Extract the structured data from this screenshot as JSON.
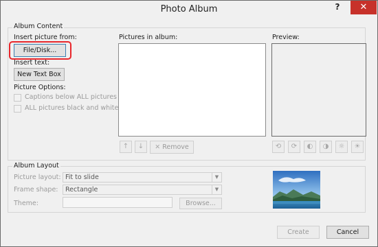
{
  "window": {
    "title": "Photo Album",
    "help": "?",
    "close": "✕"
  },
  "album_content": {
    "group_label": "Album Content",
    "insert_picture_from": "Insert picture from:",
    "file_disk_button": "File/Disk...",
    "insert_text": "Insert text:",
    "new_text_box_button": "New Text Box",
    "picture_options": "Picture Options:",
    "captions_below": "Captions below ALL pictures",
    "black_and_white": "ALL pictures black and white",
    "pictures_in_album": "Pictures in album:",
    "preview": "Preview:",
    "remove_button": "Remove"
  },
  "album_layout": {
    "group_label": "Album Layout",
    "picture_layout_label": "Picture layout:",
    "picture_layout_value": "Fit to slide",
    "frame_shape_label": "Frame shape:",
    "frame_shape_value": "Rectangle",
    "theme_label": "Theme:",
    "theme_value": "",
    "browse_button": "Browse..."
  },
  "footer": {
    "create_button": "Create",
    "cancel_button": "Cancel"
  },
  "colors": {
    "close_button": "#c7312a",
    "highlight": "#e8262b",
    "window_bg": "#f0f0f0"
  },
  "icons": {
    "move_up": "arrow-up-icon",
    "move_down": "arrow-down-icon",
    "remove": "x-icon",
    "rotate_left": "rotate-left-icon",
    "rotate_right": "rotate-right-icon",
    "contrast_up": "contrast-up-icon",
    "contrast_down": "contrast-down-icon",
    "brightness_up": "brightness-up-icon",
    "brightness_down": "brightness-down-icon"
  }
}
